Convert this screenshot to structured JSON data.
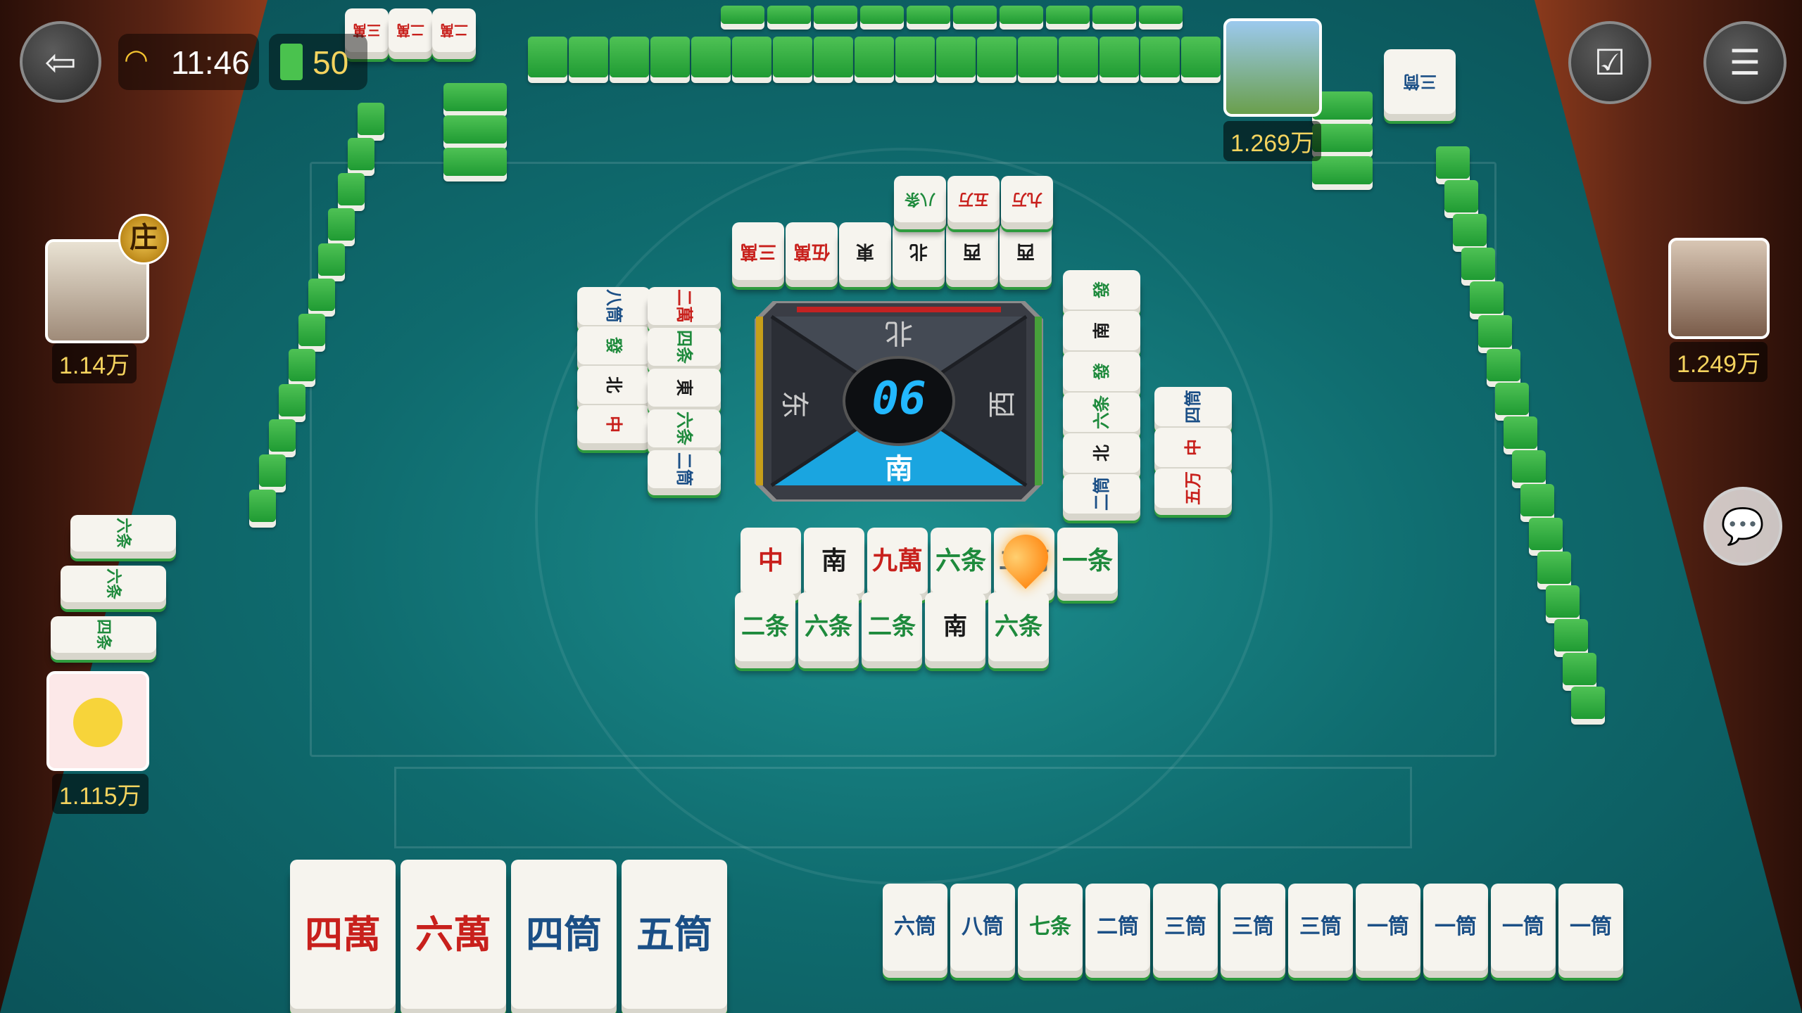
{
  "status": {
    "time": "11:46",
    "tiles_remaining": "50"
  },
  "players": {
    "top": {
      "score": "1.269万"
    },
    "left": {
      "score": "1.14万",
      "dealer_badge": "庄"
    },
    "right": {
      "score": "1.249万"
    },
    "self": {
      "score": "1.115万"
    }
  },
  "compass": {
    "counter": "06",
    "north": "北",
    "east": "东",
    "west": "西",
    "south": "南"
  },
  "icons": [
    "exit-icon",
    "wifi-icon",
    "calendar-check-icon",
    "menu-icon",
    "chat-icon"
  ],
  "discards": {
    "top_row1": [
      "三萬",
      "伍萬",
      "東",
      "北",
      "西",
      "西"
    ],
    "top_row2": [
      "八条",
      "五万",
      "九万"
    ],
    "left": [
      "八筒",
      "發",
      "北",
      "中",
      "二萬",
      "四条",
      "東",
      "六条",
      "二筒"
    ],
    "right": [
      "發",
      "南",
      "發",
      "六条",
      "北",
      "二筒",
      "四筒",
      "中",
      "五万"
    ],
    "bottom_row1": [
      "中",
      "南",
      "九萬",
      "六条",
      "二筒",
      "一条"
    ],
    "bottom_row2": [
      "二条",
      "六条",
      "二条",
      "南",
      "六条"
    ]
  },
  "hand": {
    "left_group": [
      "四萬",
      "六萬",
      "四筒",
      "五筒"
    ],
    "right_group": [
      "六筒",
      "八筒",
      "七条",
      "二筒",
      "三筒",
      "三筒",
      "三筒",
      "一筒",
      "一筒",
      "一筒",
      "一筒"
    ]
  },
  "melds": {
    "top_right": [
      "三筒"
    ],
    "left_side": [
      "六条",
      "六条",
      "四条"
    ],
    "top_left": [
      "三萬",
      "二萬",
      "二萬"
    ]
  }
}
